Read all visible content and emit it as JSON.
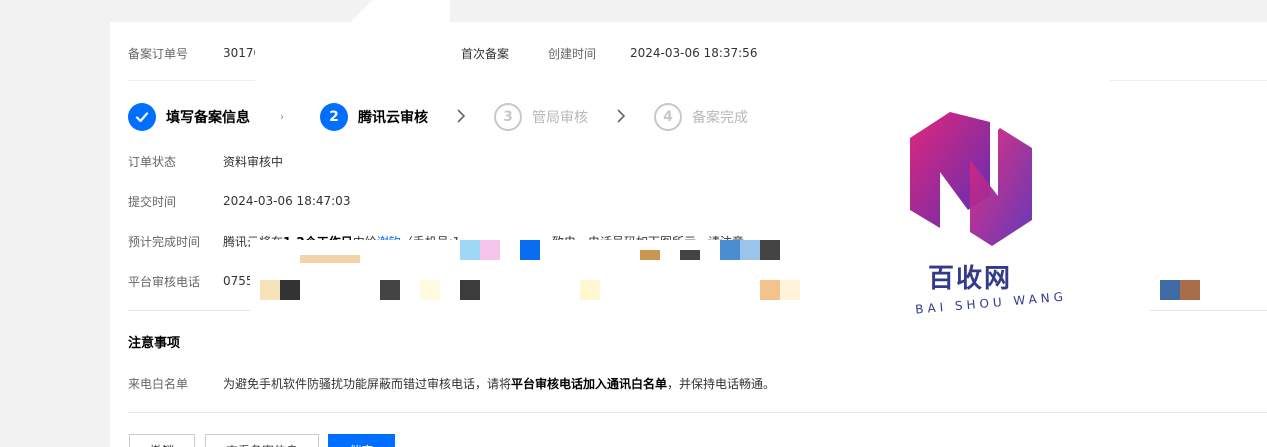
{
  "order": {
    "id_label": "备案订单号",
    "id_value": "30170",
    "type": "首次备案",
    "created_label": "创建时间",
    "created_value": "2024-03-06 18:37:56"
  },
  "steps": [
    {
      "num": "✓",
      "label": "填写备案信息"
    },
    {
      "num": "2",
      "label": "腾讯云审核"
    },
    {
      "num": "3",
      "label": "管局审核"
    },
    {
      "num": "4",
      "label": "备案完成"
    }
  ],
  "fields": {
    "status_label": "订单状态",
    "status_value": "资料审核中",
    "submit_label": "提交时间",
    "submit_value": "2024-03-06 18:47:03",
    "eta_label": "预计完成时间",
    "eta_text_1": "腾讯云将在",
    "eta_bold": "1-2个工作日",
    "eta_text_2": "内给",
    "eta_link": "谢钦",
    "eta_text_3": "（手机号:1",
    "eta_text_4": "致电，电话号码如下图所示，请注意",
    "phone_label": "平台审核电话",
    "phone_value": "0755"
  },
  "notice": {
    "title": "注意事项",
    "whitelist_label": "来电白名单",
    "whitelist_text_1": "为避免手机软件防骚扰功能屏蔽而错过审核电话，请将",
    "whitelist_bold": "平台审核电话加入通讯白名单",
    "whitelist_text_2": "，并保持电话畅通。"
  },
  "buttons": {
    "cancel": "撤销",
    "view": "查看备案信息",
    "urge": "催审"
  },
  "watermark": {
    "brand": "百收网",
    "brand_sub": "BAI SHOU WANG"
  },
  "colors": {
    "accent": "#006eff",
    "logo_gradient_start": "#d6257a",
    "logo_gradient_end": "#6b2fb0"
  }
}
